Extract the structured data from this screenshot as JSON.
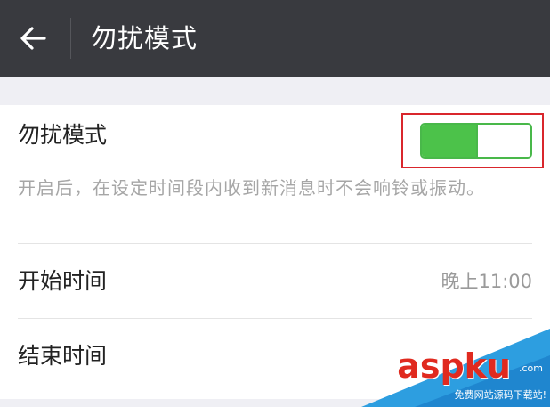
{
  "app_bar": {
    "title": "勿扰模式",
    "background": "#393a3f"
  },
  "dnd": {
    "label": "勿扰模式",
    "description": "开启后，在设定时间段内收到新消息时不会响铃或振动。",
    "toggle_on": true,
    "toggle_level": 0.5,
    "accent_color": "#4cc24a",
    "highlight_color": "#d9262c"
  },
  "rows": [
    {
      "label": "开始时间",
      "value": "晚上11:00"
    },
    {
      "label": "结束时间",
      "value": ""
    }
  ],
  "watermark": {
    "logo": "aspku",
    "suffix": ".com",
    "tagline": "免费网站源码下载站!"
  }
}
